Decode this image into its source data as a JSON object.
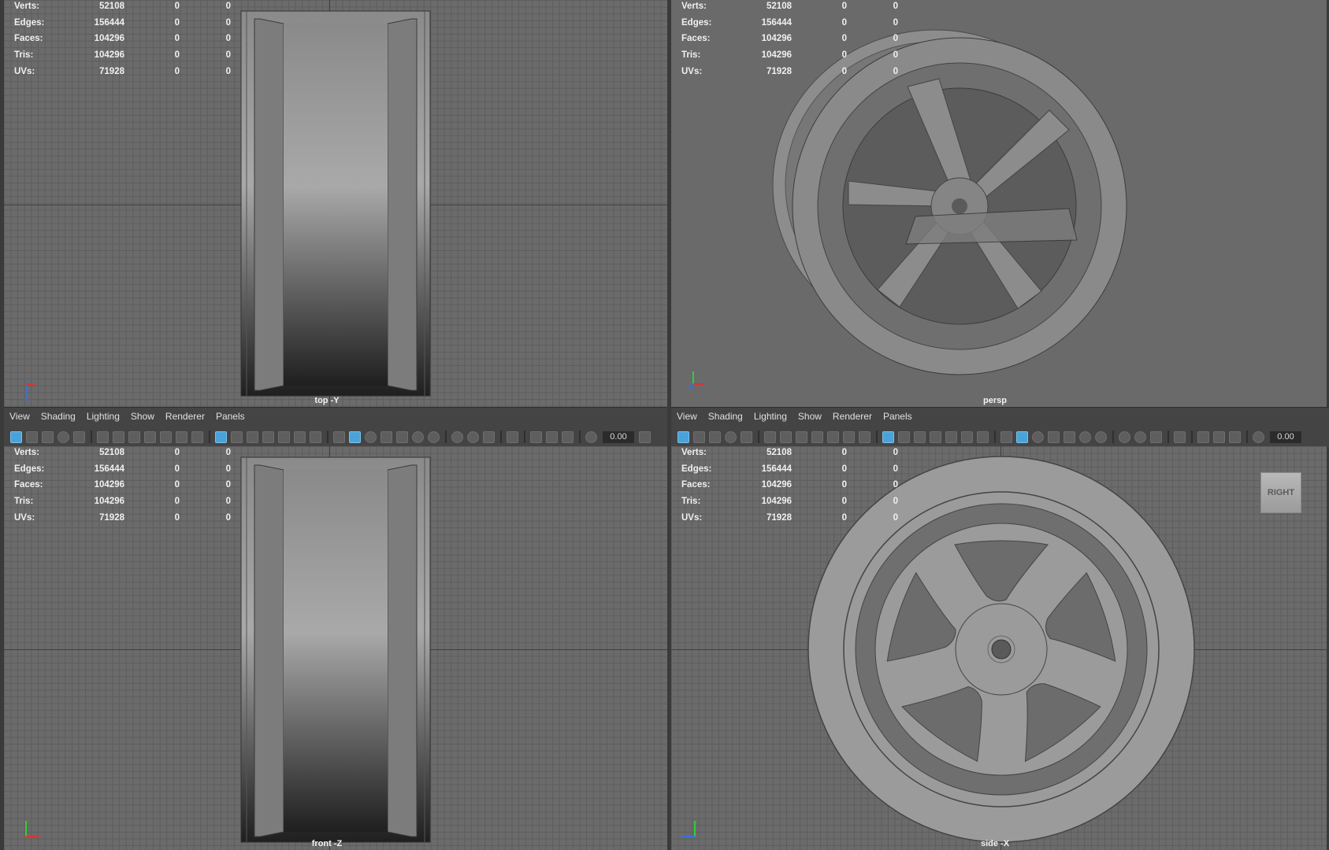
{
  "hud_stats": [
    {
      "label": "Verts:",
      "value": "52108",
      "sel": "0",
      "tri": "0"
    },
    {
      "label": "Edges:",
      "value": "156444",
      "sel": "0",
      "tri": "0"
    },
    {
      "label": "Faces:",
      "value": "104296",
      "sel": "0",
      "tri": "0"
    },
    {
      "label": "Tris:",
      "value": "104296",
      "sel": "0",
      "tri": "0"
    },
    {
      "label": "UVs:",
      "value": "71928",
      "sel": "0",
      "tri": "0"
    }
  ],
  "viewports": {
    "top": {
      "camera": "top -Y"
    },
    "persp": {
      "camera": "persp"
    },
    "front": {
      "camera": "front -Z"
    },
    "side": {
      "camera": "side -X"
    }
  },
  "panel_menu": [
    "View",
    "Shading",
    "Lighting",
    "Show",
    "Renderer",
    "Panels"
  ],
  "toolbar": {
    "field_value": "0.00"
  },
  "view_cube": {
    "label": "RIGHT"
  },
  "axis": {
    "x": "x",
    "y": "y",
    "z": "z"
  },
  "colors": {
    "accent": "#4aa3d8",
    "viewport_bg": "#6b6b6b",
    "grid": "#5d5d5d",
    "panel_bar": "#444444"
  }
}
